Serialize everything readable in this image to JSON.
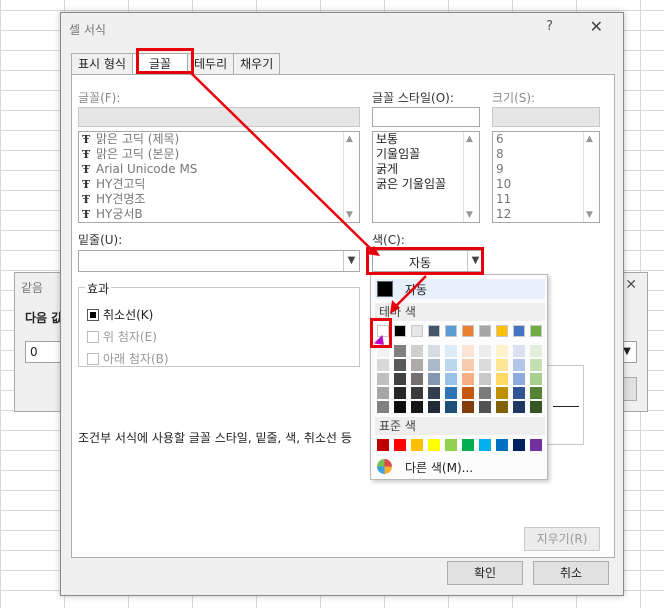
{
  "background_dialog": {
    "title": "같음",
    "prompt": "다음 값",
    "input_value": "0",
    "close_glyph": "✕"
  },
  "dialog": {
    "title": "셀 서식",
    "help_glyph": "?",
    "close_glyph": "✕",
    "tabs": [
      "표시 형식",
      "글꼴",
      "테두리",
      "채우기"
    ],
    "active_tab": "글꼴"
  },
  "font_section": {
    "font_label": "글꼴(F):",
    "style_label": "글꼴 스타일(O):",
    "size_label": "크기(S):",
    "font_items": [
      "맑은 고딕 (제목)",
      "맑은 고딕 (본문)",
      "Arial Unicode MS",
      "HY견고딕",
      "HY견명조",
      "HY궁서B"
    ],
    "style_items": [
      "보통",
      "기울임꼴",
      "굵게",
      "굵은 기울임꼴"
    ],
    "size_items": [
      "6",
      "8",
      "9",
      "10",
      "11",
      "12"
    ]
  },
  "underline_label": "밑줄(U):",
  "color_label": "색(C):",
  "color_value": "자동",
  "effects": {
    "title": "효과",
    "strike": "취소선(K)",
    "superscript": "위 첨자(E)",
    "subscript": "아래 첨자(B)",
    "strike_checked": true
  },
  "description": "조건부 서식에 사용할 글꼴 스타일, 밑줄, 색, 취소선 등",
  "buttons": {
    "clear": "지우기(R)",
    "ok": "확인",
    "cancel": "취소"
  },
  "color_popup": {
    "auto_label": "자동",
    "theme_header": "테마 색",
    "standard_header": "표준 색",
    "more_label": "다른 색(M)...",
    "theme_top": [
      "#FFFFFF",
      "#000000",
      "#E7E6E6",
      "#44546A",
      "#5B9BD5",
      "#ED7D31",
      "#A5A5A5",
      "#FFC000",
      "#4472C4",
      "#70AD47"
    ],
    "theme_shades": [
      [
        "#F2F2F2",
        "#7F7F7F",
        "#D0CECE",
        "#D6DCE4",
        "#DDEBF7",
        "#FCE4D6",
        "#EDEDED",
        "#FFF2CC",
        "#D9E1F2",
        "#E2EFDA"
      ],
      [
        "#D9D9D9",
        "#595959",
        "#AEAAAA",
        "#ACB9CA",
        "#BDD7EE",
        "#F8CBAD",
        "#DBDBDB",
        "#FFE699",
        "#B4C6E7",
        "#C6E0B4"
      ],
      [
        "#BFBFBF",
        "#404040",
        "#757171",
        "#8497B0",
        "#9BC2E6",
        "#F4B084",
        "#C9C9C9",
        "#FFD966",
        "#8EA9DB",
        "#A9D08E"
      ],
      [
        "#A6A6A6",
        "#262626",
        "#3A3838",
        "#333F4F",
        "#2F75B5",
        "#C65911",
        "#7B7B7B",
        "#BF8F00",
        "#305496",
        "#548235"
      ],
      [
        "#808080",
        "#0D0D0D",
        "#161616",
        "#222B35",
        "#1F4E78",
        "#833C0C",
        "#525252",
        "#806000",
        "#203764",
        "#375623"
      ]
    ],
    "standard": [
      "#C00000",
      "#FF0000",
      "#FFC000",
      "#FFFF00",
      "#92D050",
      "#00B050",
      "#00B0F0",
      "#0070C0",
      "#002060",
      "#7030A0"
    ]
  },
  "annotation_color": "#E8000B"
}
